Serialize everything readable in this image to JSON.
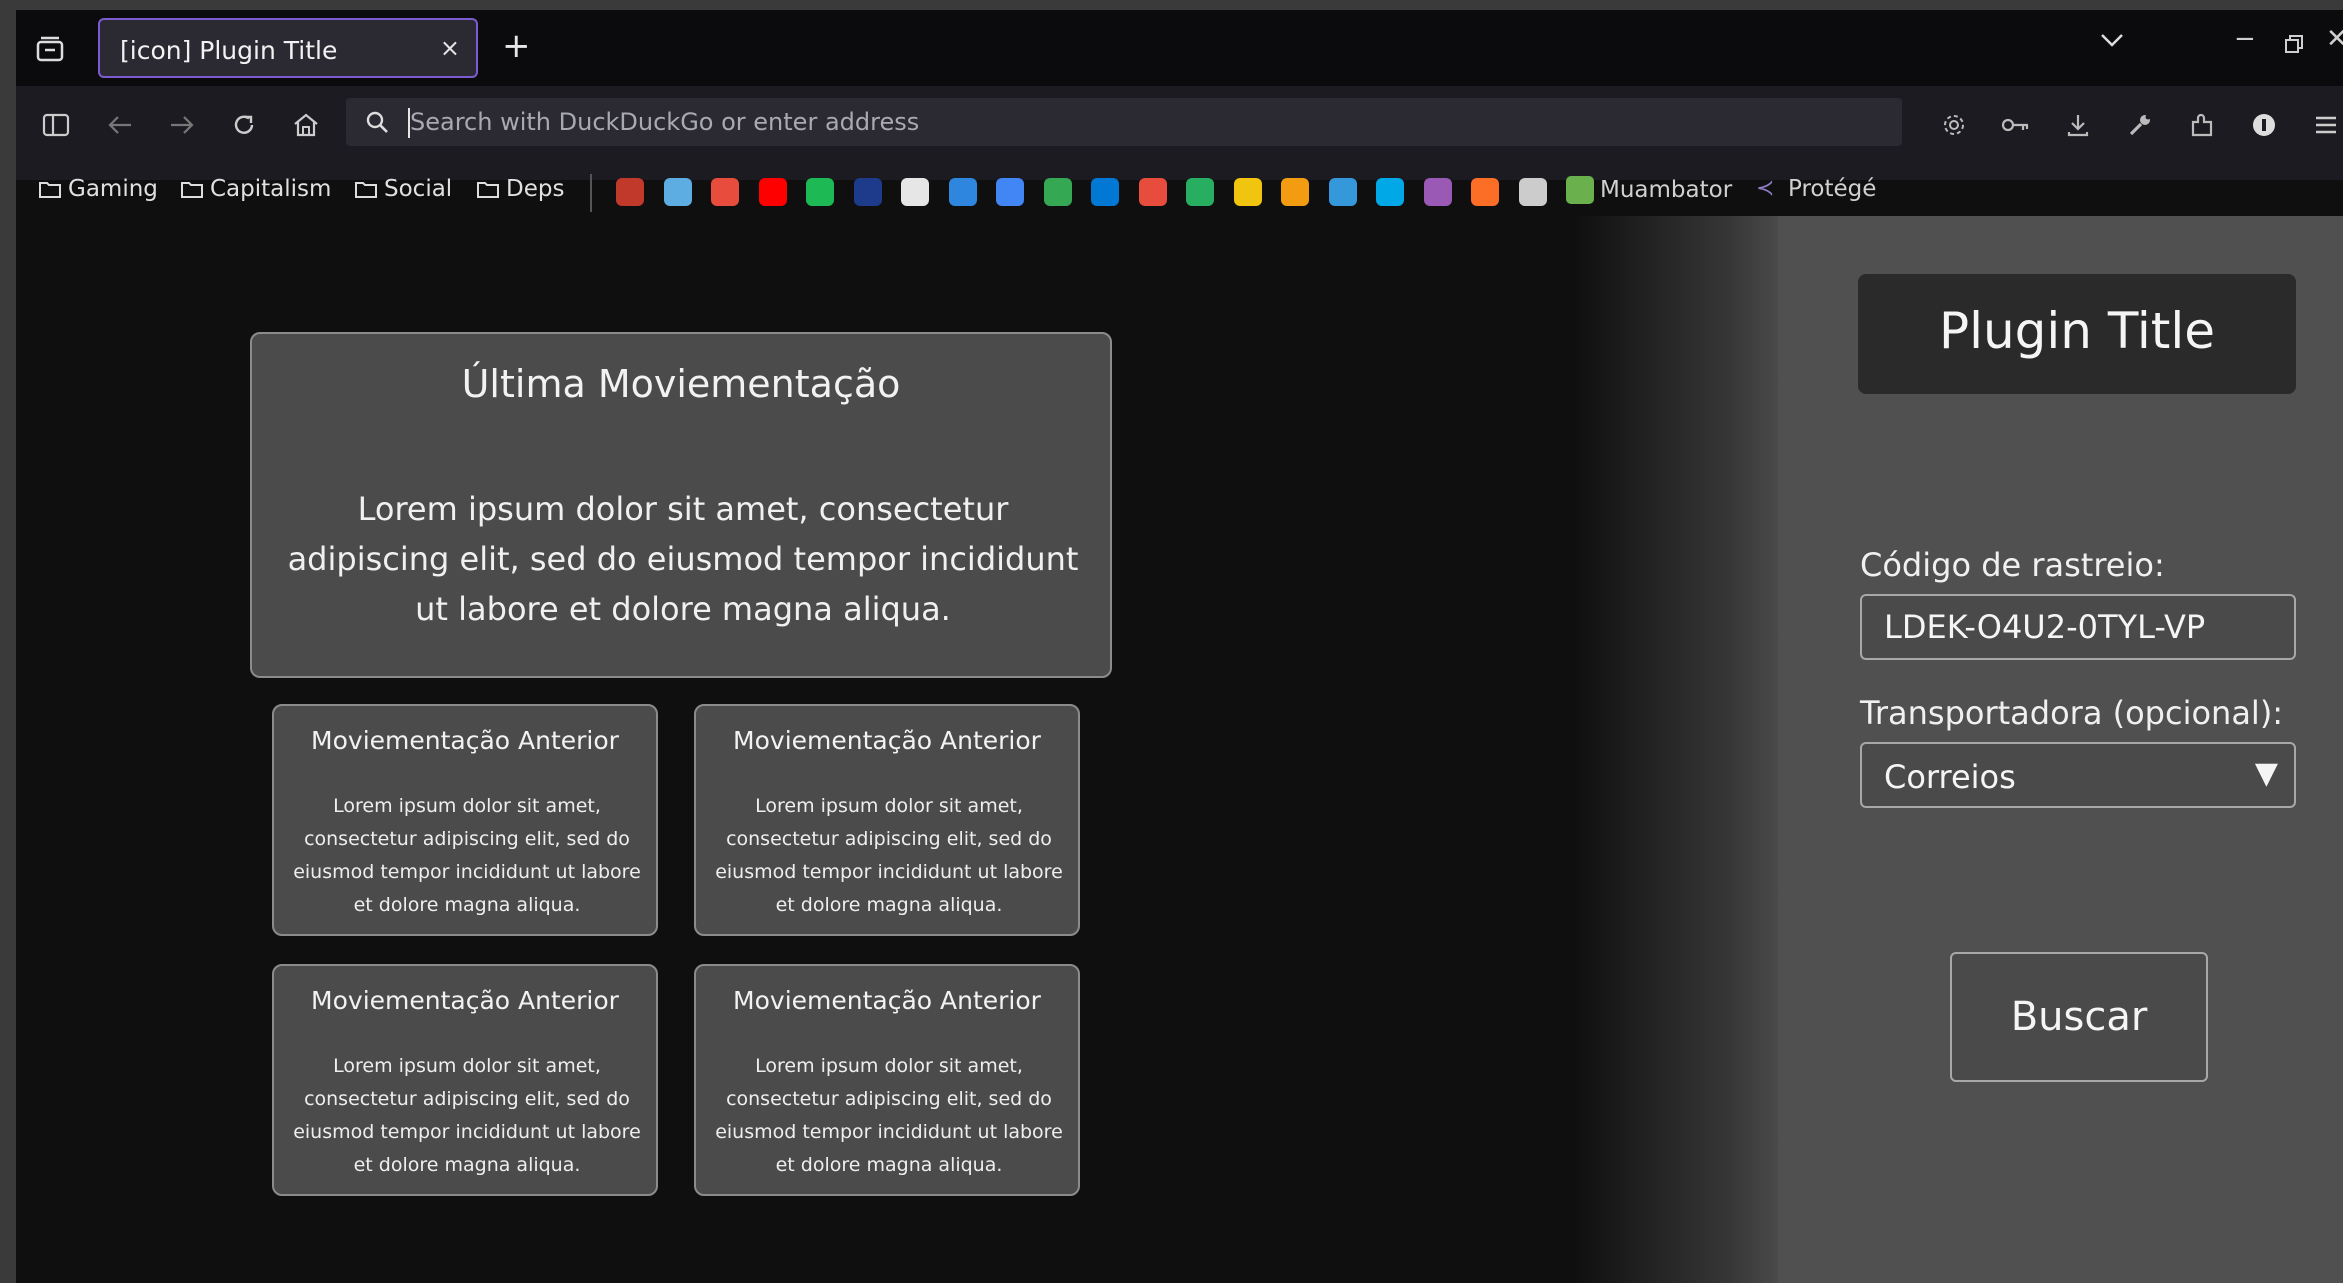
{
  "browser": {
    "tab": {
      "title": "[icon] Plugin Title",
      "close_glyph": "×"
    },
    "new_tab_glyph": "+",
    "window": {
      "minimize_glyph": "−",
      "close_glyph": "✕"
    },
    "urlbar": {
      "placeholder": "Search with DuckDuckGo or enter address"
    },
    "bookmarks": {
      "folders": [
        "Gaming",
        "Capitalism",
        "Social",
        "Deps"
      ],
      "named": [
        "Muambator",
        "Protégé"
      ],
      "favicon_colors": [
        "#c0392b",
        "#5dade2",
        "#e74c3c",
        "#ff0000",
        "#1db954",
        "#1e3a8a",
        "#e6e6e6",
        "#2e86de",
        "#4285f4",
        "#34a853",
        "#0078d4",
        "#e74c3c",
        "#27ae60",
        "#f1c40f",
        "#f39c12",
        "#3498db",
        "#00a8e8",
        "#9b59b6",
        "#fc6d26",
        "#cccccc"
      ]
    }
  },
  "page": {
    "last_movement": {
      "title": "Última Moviementação",
      "body": "Lorem ipsum dolor sit amet, consectetur adipiscing elit, sed do eiusmod tempor incididunt ut labore et dolore magna aliqua."
    },
    "previous_movements": [
      {
        "title": "Moviementação Anterior",
        "body": "Lorem ipsum dolor sit amet, consectetur adipiscing elit, sed do eiusmod tempor incididunt ut labore et dolore magna aliqua."
      },
      {
        "title": "Moviementação Anterior",
        "body": "Lorem ipsum dolor sit amet, consectetur adipiscing elit, sed do eiusmod tempor incididunt ut labore et dolore magna aliqua."
      },
      {
        "title": "Moviementação Anterior",
        "body": "Lorem ipsum dolor sit amet, consectetur adipiscing elit, sed do eiusmod tempor incididunt ut labore et dolore magna aliqua."
      },
      {
        "title": "Moviementação Anterior",
        "body": "Lorem ipsum dolor sit amet, consectetur adipiscing elit, sed do eiusmod tempor incididunt ut labore et dolore magna aliqua."
      }
    ]
  },
  "sidebar": {
    "title": "Plugin Title",
    "tracking_label": "Código de rastreio:",
    "tracking_value": "LDEK-O4U2-0TYL-VP",
    "carrier_label": "Transportadora (opcional):",
    "carrier_value": "Correios",
    "carrier_arrow": "▼",
    "search_label": "Buscar"
  }
}
